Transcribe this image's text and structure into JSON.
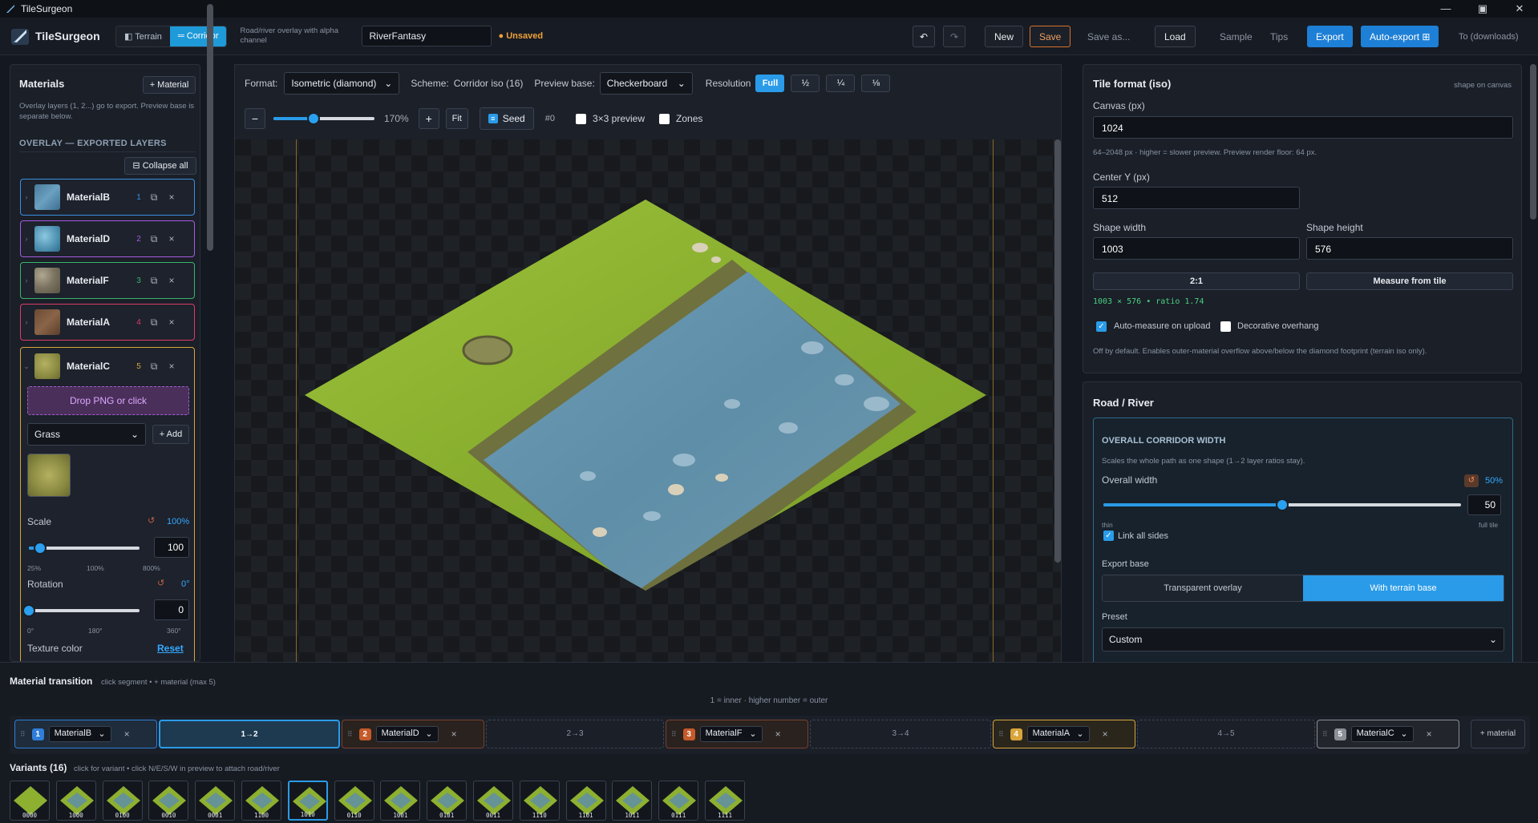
{
  "window": {
    "title": "TileSurgeon"
  },
  "toolbar": {
    "app_name": "TileSurgeon",
    "mode_terrain": "Terrain",
    "mode_corridor": "Corridor",
    "tagline": "Road/river overlay with alpha channel",
    "project_name": "RiverFantasy",
    "unsaved": "Unsaved",
    "new": "New",
    "save": "Save",
    "save_as": "Save as...",
    "load": "Load",
    "sample": "Sample",
    "tips": "Tips",
    "export": "Export",
    "auto_export": "Auto-export",
    "auto_export_icon": "⊞",
    "to_downloads": "To (downloads)"
  },
  "materials": {
    "title": "Materials",
    "add": "+ Material",
    "hint": "Overlay layers (1, 2...) go to export. Preview base is separate below.",
    "section": "OVERLAY — EXPORTED LAYERS",
    "collapse_all": "Collapse all",
    "collapse_icon": "⊟",
    "layers": [
      {
        "name": "MaterialB",
        "num": "1",
        "color": "#3a8fe0"
      },
      {
        "name": "MaterialD",
        "num": "2",
        "color": "#a85ae0"
      },
      {
        "name": "MaterialF",
        "num": "3",
        "color": "#3ab56a"
      },
      {
        "name": "MaterialA",
        "num": "4",
        "color": "#e03a6a"
      },
      {
        "name": "MaterialC",
        "num": "5",
        "color": "#d9a53b"
      }
    ],
    "expanded": {
      "drop": "Drop PNG or click",
      "type": "Grass",
      "add": "+ Add",
      "scale_label": "Scale",
      "scale_value": "100%",
      "scale_input": "100",
      "scale_ticks": [
        "25%",
        "100%",
        "800%"
      ],
      "scale_fraction": 0.1,
      "rotation_label": "Rotation",
      "rotation_value": "0°",
      "rotation_input": "0",
      "rotation_ticks": [
        "0°",
        "180°",
        "360°"
      ],
      "rotation_fraction": 0,
      "texture_color": "Texture color",
      "reset": "Reset"
    }
  },
  "preview": {
    "format_label": "Format:",
    "format": "Isometric (diamond)",
    "scheme_label": "Scheme:",
    "scheme": "Corridor iso (16)",
    "base_label": "Preview base:",
    "base": "Checkerboard",
    "res_label": "Resolution",
    "res_options": [
      "Full",
      "½",
      "¼",
      "⅛"
    ],
    "zoom": "170%",
    "zoom_fraction": 0.4,
    "fit": "Fit",
    "seed": "Seed",
    "seed_num": "#0",
    "grid_preview": "3×3 preview",
    "zones": "Zones"
  },
  "tile_format": {
    "title": "Tile format (iso)",
    "note": "shape on canvas",
    "canvas_label": "Canvas (px)",
    "canvas": "1024",
    "canvas_hint": "64–2048 px · higher = slower preview. Preview render floor: 64 px.",
    "centery_label": "Center Y (px)",
    "centery": "512",
    "sw_label": "Shape width",
    "sw": "1003",
    "sh_label": "Shape height",
    "sh": "576",
    "ratio_btn": "2:1",
    "measure_btn": "Measure from tile",
    "measure_result": "1003 × 576 • ratio 1.74",
    "auto_measure": "Auto-measure on upload",
    "decorative": "Decorative overhang",
    "overhang_hint": "Off by default. Enables outer-material overflow above/below the diamond footprint (terrain iso only)."
  },
  "road": {
    "title": "Road / River",
    "overall_title": "OVERALL CORRIDOR WIDTH",
    "overall_hint": "Scales the whole path as one shape (1→2 layer ratios stay).",
    "width_label": "Overall width",
    "width_pct": "50%",
    "width_input": "50",
    "width_fraction": 0.5,
    "thin": "thin",
    "full": "full tile",
    "link": "Link all sides",
    "export_base": "Export base",
    "transparent": "Transparent overlay",
    "with_base": "With terrain base",
    "preset_label": "Preset",
    "preset": "Custom"
  },
  "transition": {
    "title": "Material transition",
    "hint": "click segment • + material (max 5)",
    "center_hint": "1 = inner · higher number = outer",
    "nodes": [
      {
        "num": "1",
        "name": "MaterialB",
        "badge": "#2f7ed8",
        "border": "#2f7ed8"
      },
      {
        "num": "2",
        "name": "MaterialD",
        "badge": "#c55a2a",
        "border": "#7a4030"
      },
      {
        "num": "3",
        "name": "MaterialF",
        "badge": "#c55a2a",
        "border": "#7a4030"
      },
      {
        "num": "4",
        "name": "MaterialA",
        "badge": "#d9a53b",
        "border": "#d9a53b"
      },
      {
        "num": "5",
        "name": "MaterialC",
        "badge": "#8a8f98",
        "border": "#8a8f98"
      }
    ],
    "segments": [
      "1→2",
      "2→3",
      "3→4",
      "4→5"
    ],
    "add": "+ material"
  },
  "variants": {
    "title": "Variants (16)",
    "hint": "click for variant • click N/E/S/W in preview to attach road/river",
    "items": [
      "0000",
      "1000",
      "0100",
      "0010",
      "0001",
      "1100",
      "1010",
      "0110",
      "1001",
      "0101",
      "0011",
      "1110",
      "1101",
      "1011",
      "0111",
      "1111"
    ]
  }
}
